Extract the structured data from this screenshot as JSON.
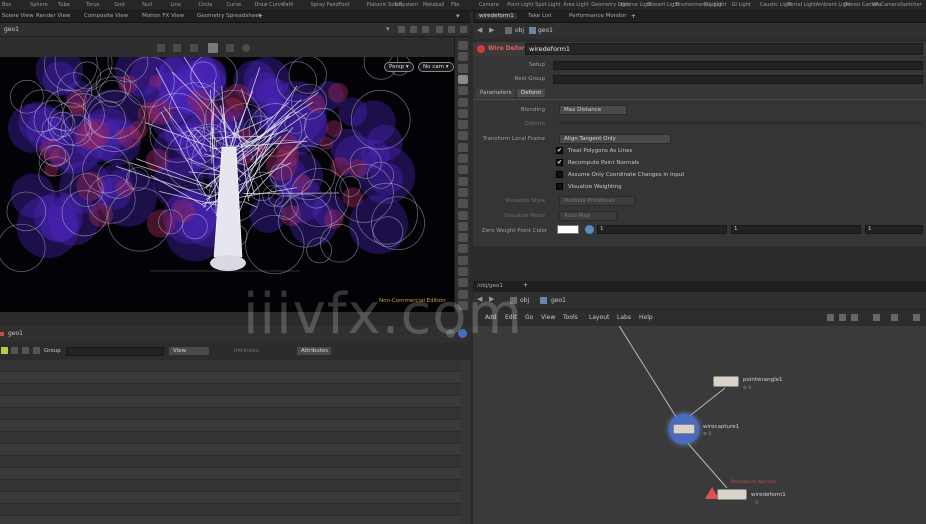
{
  "shelf": {
    "tools": [
      "Box",
      "Sphere",
      "Tube",
      "Torus",
      "Grid",
      "Null",
      "Line",
      "Circle",
      "Curve",
      "Draw Curve",
      "Path",
      "Spray Paint",
      "Font",
      "Platonic Solids",
      "L-System",
      "Metaball",
      "File",
      "Camera",
      "Point Light",
      "Spot Light",
      "Area Light",
      "Geometry Light",
      "Volume Light",
      "Distant Light",
      "Environment Light",
      "Sky Light",
      "GI Light",
      "Caustic Light",
      "Portal Light",
      "Ambient Light",
      "Stereo Camera",
      "VR Camera",
      "Switcher"
    ]
  },
  "left_tabs": [
    "Scene View",
    "Render View",
    "Composite View",
    "Motion FX View",
    "Geometry Spreadsheet"
  ],
  "right_tabs": [
    "wiredeform1",
    "Take List",
    "Performance Monitor"
  ],
  "viewport": {
    "path_label": "geo1",
    "persp_label": "Persp ▾",
    "cam_label": "No cam ▾",
    "edition_label": "Non-Commercial Edition"
  },
  "params": {
    "path_obj": "obj",
    "path_geo": "geo1",
    "node_type": "Wire Deform",
    "node_name": "wiredeform1",
    "tabs": [
      "Parameters",
      "Deform"
    ],
    "setup_label": "Setup",
    "rest_group_label": "Rest Group",
    "blending_label": "Blending",
    "blending_value": "Max Distance",
    "deform_label": "Deform",
    "transform_label": "Transform Local Frame",
    "transform_value": "Align Tangent Only",
    "checks": [
      {
        "label": "Treat Polygons As Lines",
        "checked": true,
        "dim": false
      },
      {
        "label": "Recompute Point Normals",
        "checked": true,
        "dim": false
      },
      {
        "label": "Assume Only Coordinate Changes in Input",
        "checked": false,
        "dim": false
      },
      {
        "label": "Visualize Weighting",
        "checked": false,
        "dim": false
      }
    ],
    "visualize_style_label": "Visualize Style",
    "visualize_style_value": "Multiple Primitives",
    "visualize_mode_label": "Visualize Mode",
    "visualize_mode_value": "Auto Map",
    "zero_weight_label": "Zero Weight Point Color",
    "zero_weight_values": [
      "1",
      "1",
      "1"
    ],
    "colors": {
      "swatch": "#ffffff",
      "node_type_red": "#d33b3b"
    }
  },
  "network": {
    "tabs": [
      "/obj/geo1"
    ],
    "path_obj": "obj",
    "path_geo": "geo1",
    "menu": [
      "Add",
      "Edit",
      "Go",
      "View",
      "Tools",
      "Layout",
      "Labs",
      "Help"
    ],
    "nodes": [
      {
        "name": "pointwrangle1",
        "sub": "⚙ 0"
      },
      {
        "name": "wirecapture1",
        "sub": "⚙ 0"
      },
      {
        "name": "wiredeform1",
        "sub": "0"
      }
    ],
    "warning_text": "Recompute Normals"
  },
  "spreadsheet": {
    "title": "geo1",
    "group_label": "Group",
    "view_label": "View",
    "intrinsics_label": "Intrinsics",
    "attributes_label": "Attributes"
  },
  "watermark": "iiivfx.com"
}
